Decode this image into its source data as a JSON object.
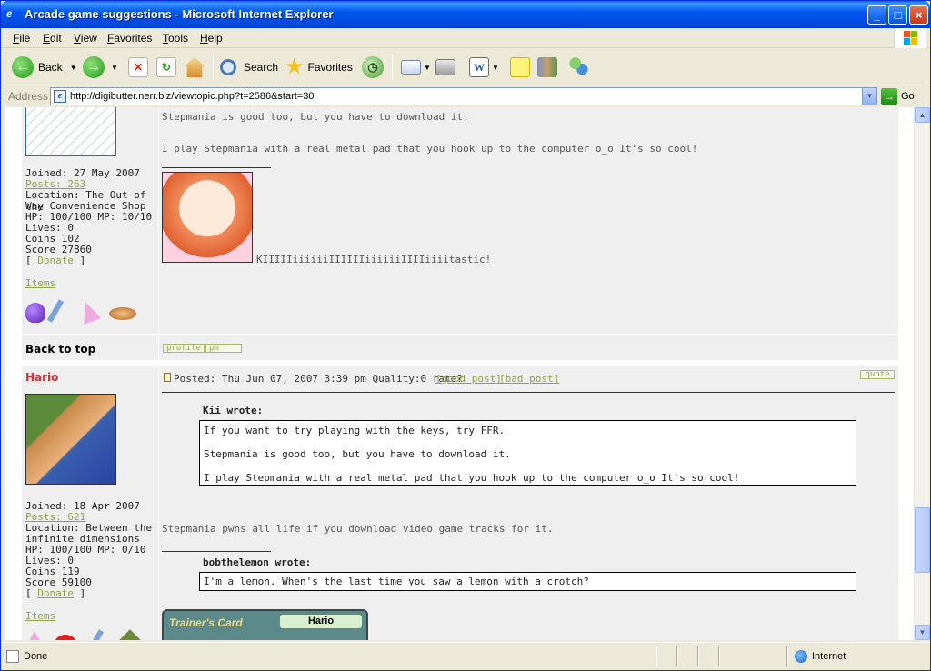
{
  "window": {
    "title": "Arcade game suggestions - Microsoft Internet Explorer",
    "minimize": "_",
    "maximize": "□",
    "close": "×"
  },
  "menu": [
    "File",
    "Edit",
    "View",
    "Favorites",
    "Tools",
    "Help"
  ],
  "toolbar": {
    "back_label": "Back",
    "search_label": "Search",
    "favorites_label": "Favorites"
  },
  "address": {
    "label": "Address",
    "url": "http://digibutter.nerr.biz/viewtopic.php?t=2586&start=30",
    "go_label": "Go"
  },
  "post1": {
    "text_line1": "Stepmania is good too, but you have to download it.",
    "text_line2": "I play Stepmania with a real metal pad that you hook up to the computer o_o It's so cool!",
    "signature_text": "KIIIIIiiiiiiIIIIIIiiiiiiIIIIiiiitastic!",
    "joined": "Joined: 27 May 2007",
    "posts": "Posts: 263",
    "location_line1": "Location: The Out of the",
    "location_line2": "Way Convenience Shop",
    "hp_mp": "HP: 100/100 MP: 10/10",
    "lives": "Lives: 0",
    "coins": "Coins 102",
    "score": "Score 27860",
    "donate": "Donate",
    "items": "Items",
    "back_to_top": "Back to top",
    "profile_btn": "profile",
    "pm_btn": "pm"
  },
  "post2": {
    "author": "Hario",
    "posted": "Posted: Thu Jun 07, 2007 3:39 pm Quality:0 rate?",
    "good_post": "[good post]",
    "bad_post": "[bad post]",
    "quote_btn": "quote",
    "quote1_author": "Kii wrote:",
    "quote1_line1": "If you want to try playing with the keys, try FFR.",
    "quote1_line2": "Stepmania is good too, but you have to download it.",
    "quote1_line3": "I play Stepmania with a real metal pad that you hook up to the computer o_o It's so cool!",
    "body": "Stepmania pwns all life if you download video game tracks for it.",
    "quote2_author": "bobthelemon wrote:",
    "quote2_line1": "I'm a lemon. When's the last time you saw a lemon with a crotch?",
    "card_title": "Trainer's Card",
    "card_name": "Hario",
    "joined": "Joined: 18 Apr 2007",
    "posts": "Posts: 621",
    "location_line1": "Location: Between the",
    "location_line2": "infinite dimensions",
    "hp_mp": "HP: 100/100 MP: 0/10",
    "lives": "Lives: 0",
    "coins": "Coins 119",
    "score": "Score 59100",
    "donate": "Donate",
    "items": "Items"
  },
  "status": {
    "text": "Done",
    "zone": "Internet"
  }
}
